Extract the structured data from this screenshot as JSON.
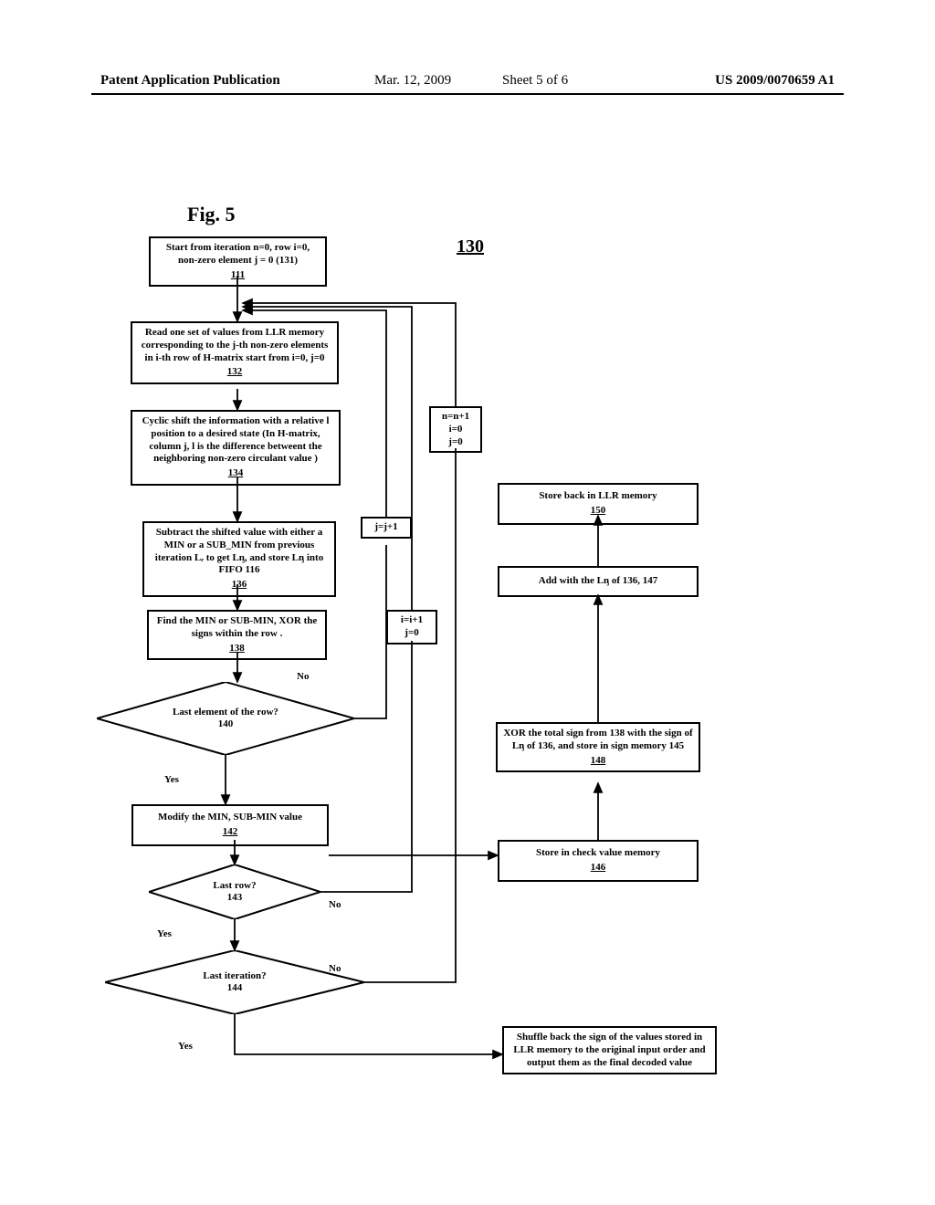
{
  "header": {
    "publication": "Patent Application Publication",
    "date": "Mar. 12, 2009",
    "sheet": "Sheet 5 of 6",
    "docnum": "US 2009/0070659 A1"
  },
  "figure": {
    "label": "Fig. 5",
    "topref": "130"
  },
  "boxes": {
    "b111": {
      "text": "Start from iteration n=0, row i=0, non-zero element j = 0 (131)",
      "ref": "111"
    },
    "b132": {
      "text": "Read one set of values from LLR memory corresponding to the j-th non-zero elements in i-th row of H-matrix start from i=0, j=0",
      "ref": "132"
    },
    "b134": {
      "text": "Cyclic shift the information with a relative l position to a desired state (In H-matrix, column j, l is the difference betweent the neighboring non-zero circulant  value )",
      "ref": "134"
    },
    "b136": {
      "text": "Subtract the shifted value with either a MIN or a SUB_MIN from previous iteration Lᵣ to get Lᶇ, and store Lᶇ into FIFO 116",
      "ref": "136"
    },
    "b138": {
      "text": "Find the  MIN or SUB-MIN, XOR the signs within the row .",
      "ref": "138"
    },
    "d140": {
      "text": "Last element of the row?\n140"
    },
    "b142": {
      "text": "Modify the MIN, SUB-MIN value",
      "ref": "142"
    },
    "d143": {
      "text": "Last row?\n143"
    },
    "d144": {
      "text": "Last iteration?\n144"
    },
    "bShuffle": {
      "text": "Shuffle back  the sign of the values stored in  LLR memory to the original input order and output them as the final decoded value"
    },
    "bJJ": {
      "text": "j=j+1"
    },
    "bII": {
      "text": "i=i+1\nj=0"
    },
    "bNN": {
      "text": "n=n+1\ni=0\nj=0"
    },
    "b150": {
      "text": "Store back in LLR memory",
      "ref": "150"
    },
    "b147": {
      "text": "Add with the  Lᶇ of 136, 147"
    },
    "b148": {
      "text": "XOR the total sign from 138 with the sign of Lᶇ of 136, and store in sign memory 145",
      "ref": "148"
    },
    "b146": {
      "text": "Store in check value memory",
      "ref": "146"
    }
  },
  "labels": {
    "yes": "Yes",
    "no": "No"
  }
}
